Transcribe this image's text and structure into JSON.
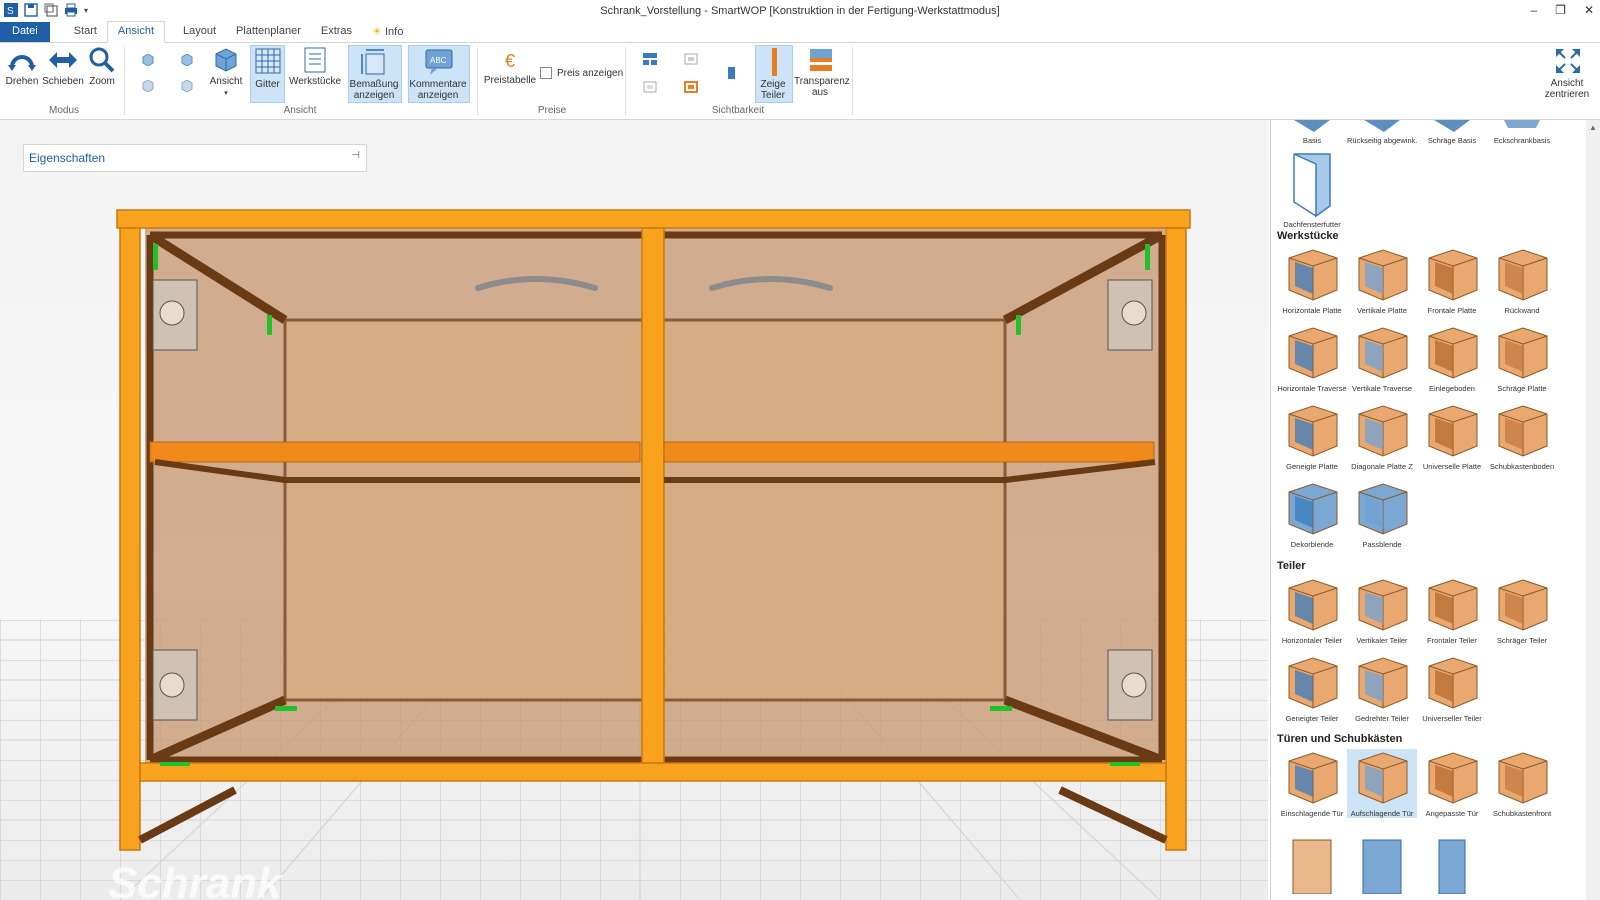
{
  "window": {
    "title": "Schrank_Vorstellung - SmartWOP [Konstruktion in der Fertigung-Werkstattmodus]",
    "controls": [
      "–",
      "❐",
      "✕"
    ]
  },
  "tabs": [
    {
      "label": "Datei"
    },
    {
      "label": "Start"
    },
    {
      "label": "Ansicht"
    },
    {
      "label": "Layout"
    },
    {
      "label": "Plattenplaner"
    },
    {
      "label": "Extras"
    },
    {
      "label": "Info"
    }
  ],
  "ribbon": {
    "modus": {
      "label": "Modus",
      "drehen": "Drehen",
      "schieben": "Schieben",
      "zoom": "Zoom"
    },
    "ansicht": {
      "label": "Ansicht",
      "ansicht_btn": "Ansicht",
      "gitter": "Gitter",
      "werkstuecke": "Werkstücke",
      "bemassung": "Bemaßung anzeigen",
      "kommentare": "Kommentare anzeigen"
    },
    "preise": {
      "label": "Preise",
      "preistabelle": "Preistabelle",
      "preis_anzeigen": "Preis anzeigen",
      "checked": false
    },
    "sichtbarkeit": {
      "label": "Sichtbarkeit",
      "zeige_teiler": "Zeige Teiler",
      "transparenz": "Transparenz aus"
    },
    "ansicht_zentrieren": "Ansicht zentrieren"
  },
  "properties": {
    "label": "Eigenschaften"
  },
  "viewport": {
    "watermark": "Schrank"
  },
  "colors": {
    "accent": "#1e5fa6",
    "cabinet": "#f9a21e",
    "cabinet_dark": "#6a3a14",
    "selected": "#cde3f7"
  },
  "panel": {
    "top_items": [
      "Basis",
      "Rückseitig abgewink...",
      "Schräge Basis",
      "Eckschrankbasis",
      "Dachfensterfutter"
    ],
    "werkstuecke": {
      "title": "Werkstücke",
      "items": [
        "Horizontale Platte",
        "Vertikale Platte",
        "Frontale Platte",
        "Rückwand",
        "Horizontale Traverse",
        "Vertikale Traverse",
        "Einlegeboden",
        "Schräge Platte",
        "Geneigte Platte",
        "Diagonale Platte Z",
        "Universelle Platte",
        "Schubkastenboden",
        "Dekorblende",
        "Passblende"
      ]
    },
    "teiler": {
      "title": "Teiler",
      "items": [
        "Horizontaler Teiler",
        "Vertikaler Teiler",
        "Frontaler Teiler",
        "Schräger Teiler",
        "Geneigter Teiler",
        "Gedrehter Teiler",
        "Universeller Teiler"
      ]
    },
    "tueren": {
      "title": "Türen und Schubkästen",
      "items": [
        "Einschlagende Tür",
        "Aufschlagende Tür",
        "Angepasste Tür",
        "Schubkastenfront"
      ],
      "selected": "Aufschlagende Tür"
    }
  }
}
